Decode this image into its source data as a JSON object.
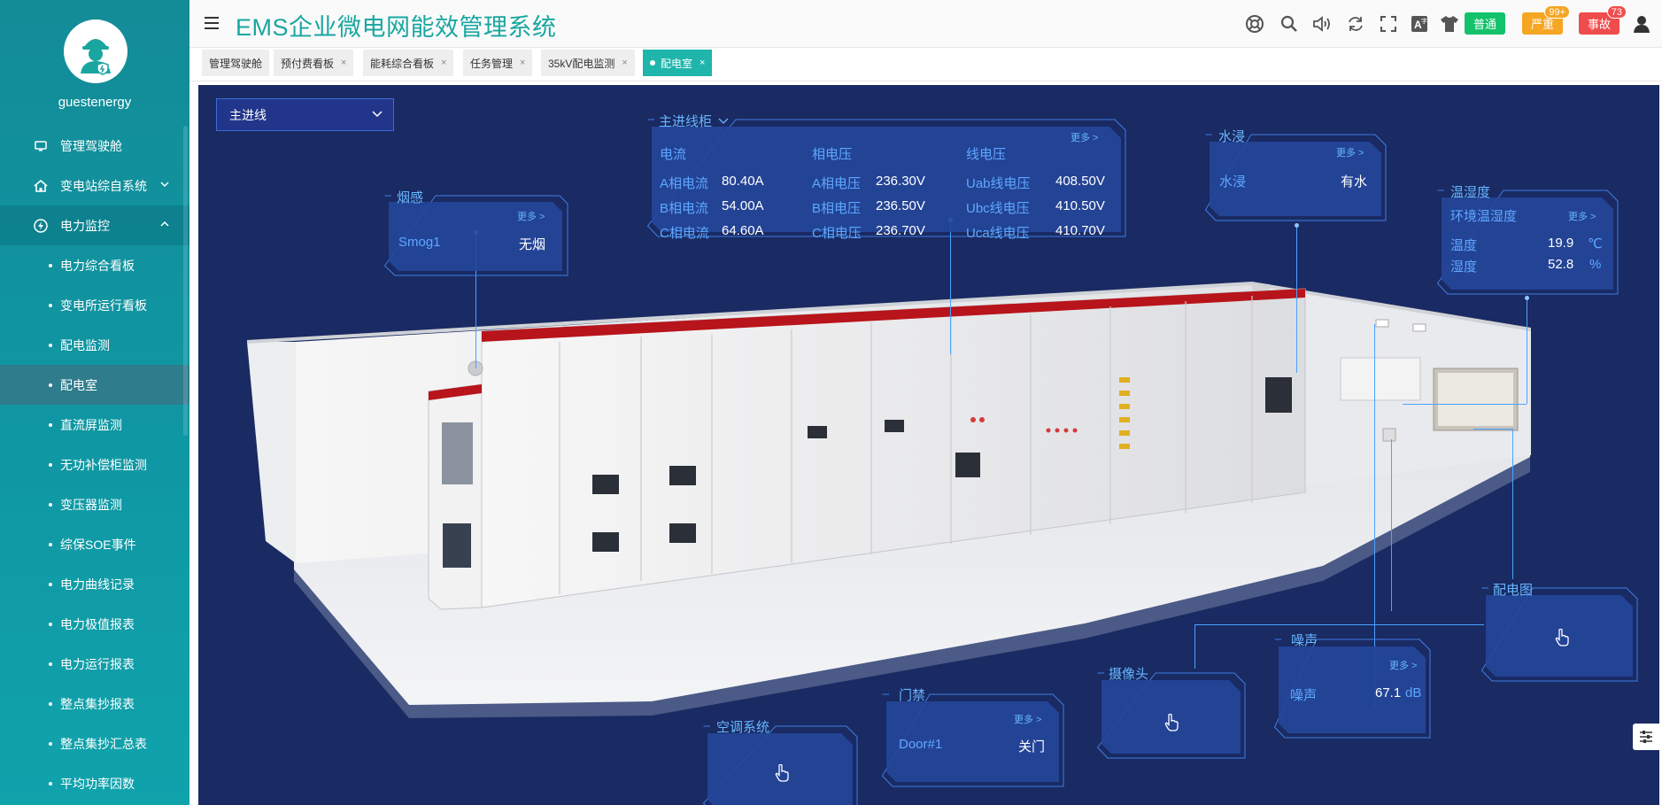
{
  "user": {
    "name": "guestenergy",
    "avatar_icon": "engineer-avatar-icon"
  },
  "sidebar": {
    "items": [
      {
        "label": "管理驾驶舱",
        "icon": "monitor-icon"
      },
      {
        "label": "变电站综自系统",
        "icon": "home-icon"
      },
      {
        "label": "电力监控",
        "icon": "power-icon"
      }
    ],
    "sub_items": [
      {
        "label": "电力综合看板"
      },
      {
        "label": "变电所运行看板"
      },
      {
        "label": "配电监测"
      },
      {
        "label": "配电室"
      },
      {
        "label": "直流屏监测"
      },
      {
        "label": "无功补偿柜监测"
      },
      {
        "label": "变压器监测"
      },
      {
        "label": "综保SOE事件"
      },
      {
        "label": "电力曲线记录"
      },
      {
        "label": "电力极值报表"
      },
      {
        "label": "电力运行报表"
      },
      {
        "label": "整点集抄报表"
      },
      {
        "label": "整点集抄汇总表"
      },
      {
        "label": "平均功率因数"
      }
    ]
  },
  "header": {
    "title": "EMS企业微电网能效管理系统",
    "status_normal": "普通",
    "status_serious": "严重",
    "status_serious_count": "99+",
    "status_accident": "事故",
    "status_accident_count": "73"
  },
  "tabs": [
    {
      "label": "管理驾驶舱",
      "closable": false
    },
    {
      "label": "预付费看板",
      "closable": true
    },
    {
      "label": "能耗综合看板",
      "closable": true
    },
    {
      "label": "任务管理",
      "closable": true
    },
    {
      "label": "35kV配电监测",
      "closable": true
    },
    {
      "label": "配电室",
      "closable": true,
      "active": true
    }
  ],
  "scene": {
    "line_select": "主进线",
    "smoke": {
      "title": "烟感",
      "more": "更多 >",
      "name": "Smog1",
      "value": "无烟"
    },
    "main_cabinet": {
      "title": "主进线柜",
      "more": "更多 >",
      "col_current": "电流",
      "col_phase_voltage": "相电压",
      "col_line_voltage": "线电压",
      "currents": [
        {
          "label": "A相电流",
          "value": "80.40A"
        },
        {
          "label": "B相电流",
          "value": "54.00A"
        },
        {
          "label": "C相电流",
          "value": "64.60A"
        }
      ],
      "phase_voltages": [
        {
          "label": "A相电压",
          "value": "236.30V"
        },
        {
          "label": "B相电压",
          "value": "236.50V"
        },
        {
          "label": "C相电压",
          "value": "236.70V"
        }
      ],
      "line_voltages": [
        {
          "label": "Uab线电压",
          "value": "408.50V"
        },
        {
          "label": "Ubc线电压",
          "value": "410.50V"
        },
        {
          "label": "Uca线电压",
          "value": "410.70V"
        }
      ]
    },
    "water": {
      "title": "水浸",
      "more": "更多 >",
      "label": "水浸",
      "value": "有水"
    },
    "temp_humidity": {
      "title": "温湿度",
      "subtitle": "环境温湿度",
      "more": "更多 >",
      "temp_label": "温度",
      "temp_value": "19.9",
      "temp_unit": "℃",
      "hum_label": "湿度",
      "hum_value": "52.8",
      "hum_unit": "%"
    },
    "distribution_map": {
      "title": "配电图"
    },
    "noise": {
      "title": "噪声",
      "more": "更多 >",
      "label": "噪声",
      "value": "67.1",
      "unit": "dB"
    },
    "camera": {
      "title": "摄像头"
    },
    "access": {
      "title": "门禁",
      "more": "更多 >",
      "name": "Door#1",
      "value": "关门"
    },
    "aircon": {
      "title": "空调系统"
    }
  },
  "colors": {
    "sidebar": "#0f97a3",
    "accent": "#1aa6a0",
    "scene_bg": "#1a2a63",
    "panel_label": "#5ea8ff",
    "normal": "#13c26b",
    "serious": "#f5a623",
    "accident": "#ef4d4d"
  }
}
